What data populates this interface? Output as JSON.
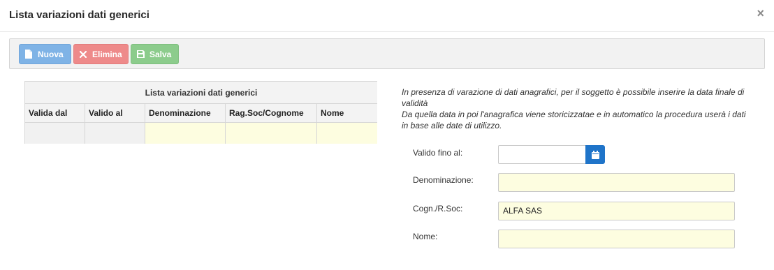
{
  "modal": {
    "title": "Lista variazioni dati generici",
    "close_glyph": "×"
  },
  "toolbar": {
    "nuova_label": "Nuova",
    "nuova_icon": "file-icon",
    "elimina_label": "Elimina",
    "elimina_icon": "x-icon",
    "salva_label": "Salva",
    "salva_icon": "save-icon",
    "colors": {
      "nuova": "#7fb3e6",
      "elimina": "#ee8a8a",
      "salva": "#8ccc8c"
    }
  },
  "grid": {
    "caption": "Lista variazioni dati generici",
    "columns": [
      "Valida dal",
      "Valido al",
      "Denominazione",
      "Rag.Soc/Cognome",
      "Nome"
    ],
    "rows": [
      [
        "",
        "",
        "",
        "",
        ""
      ]
    ]
  },
  "info": {
    "line1": "In presenza di varazione di dati anagrafici, per il soggetto è possibile inserire la data finale di validità",
    "line2": "Da quella data in poi l'anagrafica viene storicizzatae e in automatico la procedura userà i dati in base alle date di utilizzo."
  },
  "form": {
    "valido_label": "Valido fino al:",
    "valido_value": "",
    "calendar_icon": "calendar-icon",
    "denominazione_label": "Denominazione:",
    "denominazione_value": "",
    "cognome_label": "Cogn./R.Soc:",
    "cognome_value": "ALFA SAS",
    "nome_label": "Nome:",
    "nome_value": ""
  }
}
